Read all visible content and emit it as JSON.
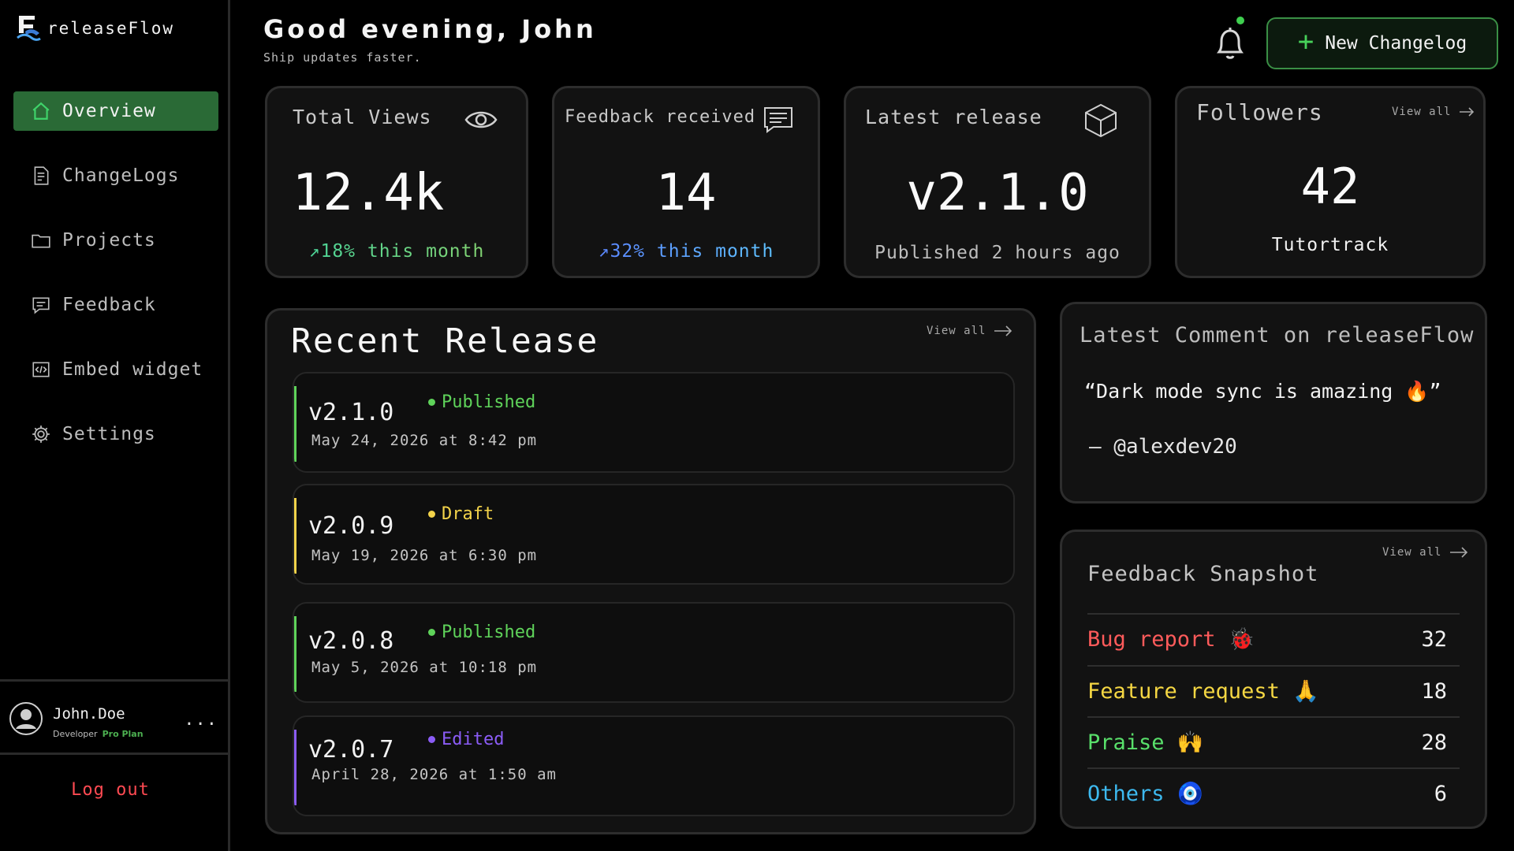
{
  "app": {
    "name": "releaseFlow"
  },
  "sidebar": {
    "items": [
      {
        "label": "Overview",
        "icon": "home-icon",
        "active": true
      },
      {
        "label": "ChangeLogs",
        "icon": "document-icon"
      },
      {
        "label": "Projects",
        "icon": "folder-icon"
      },
      {
        "label": "Feedback",
        "icon": "message-icon"
      },
      {
        "label": "Embed widget",
        "icon": "code-icon"
      },
      {
        "label": "Settings",
        "icon": "gear-icon"
      }
    ],
    "user": {
      "name": "John.Doe",
      "role": "Developer",
      "plan": "Pro Plan",
      "more": "..."
    },
    "logout_label": "Log out"
  },
  "header": {
    "greeting": "Good evening, John",
    "subtitle": "Ship updates faster.",
    "new_button_label": "New Changelog",
    "notification_dot_color": "#3fcf4f"
  },
  "stats": {
    "views": {
      "label": "Total Views",
      "value": "12.4k",
      "sub": "↗18% this month"
    },
    "feedback": {
      "label": "Feedback received",
      "value": "14",
      "sub": "↗32% this month"
    },
    "release": {
      "label": "Latest release",
      "value": "v2.1.0",
      "sub": "Published 2 hours ago"
    },
    "followers": {
      "label": "Followers",
      "view_all": "View all",
      "value": "42",
      "sub": "Tutortrack"
    }
  },
  "recent": {
    "title": "Recent Release",
    "view_all": "View all",
    "items": [
      {
        "version": "v2.1.0",
        "status": "Published",
        "date": "May 24, 2026 at 8:42 pm",
        "color": "#5fd35a"
      },
      {
        "version": "v2.0.9",
        "status": "Draft",
        "date": "May 19, 2026 at 6:30 pm",
        "color": "#f3d34a"
      },
      {
        "version": "v2.0.8",
        "status": "Published",
        "date": "May 5, 2026 at 10:18 pm",
        "color": "#5fd35a"
      },
      {
        "version": "v2.0.7",
        "status": "Edited",
        "date": "April 28, 2026 at 1:50 am",
        "color": "#8b5cf6"
      }
    ]
  },
  "comment": {
    "title": "Latest Comment on releaseFlow",
    "text": "“Dark mode sync is amazing 🔥”",
    "author": "– @alexdev20"
  },
  "snapshot": {
    "title": "Feedback Snapshot",
    "view_all": "View all",
    "rows": [
      {
        "label": "Bug report 🐞",
        "count": "32",
        "color": "#ff5b5b"
      },
      {
        "label": "Feature request 🙏",
        "count": "18",
        "color": "#f5d743"
      },
      {
        "label": "Praise 🙌",
        "count": "28",
        "color": "#59e06b"
      },
      {
        "label": "Others 🧿",
        "count": "6",
        "color": "#3db9ef"
      }
    ]
  }
}
